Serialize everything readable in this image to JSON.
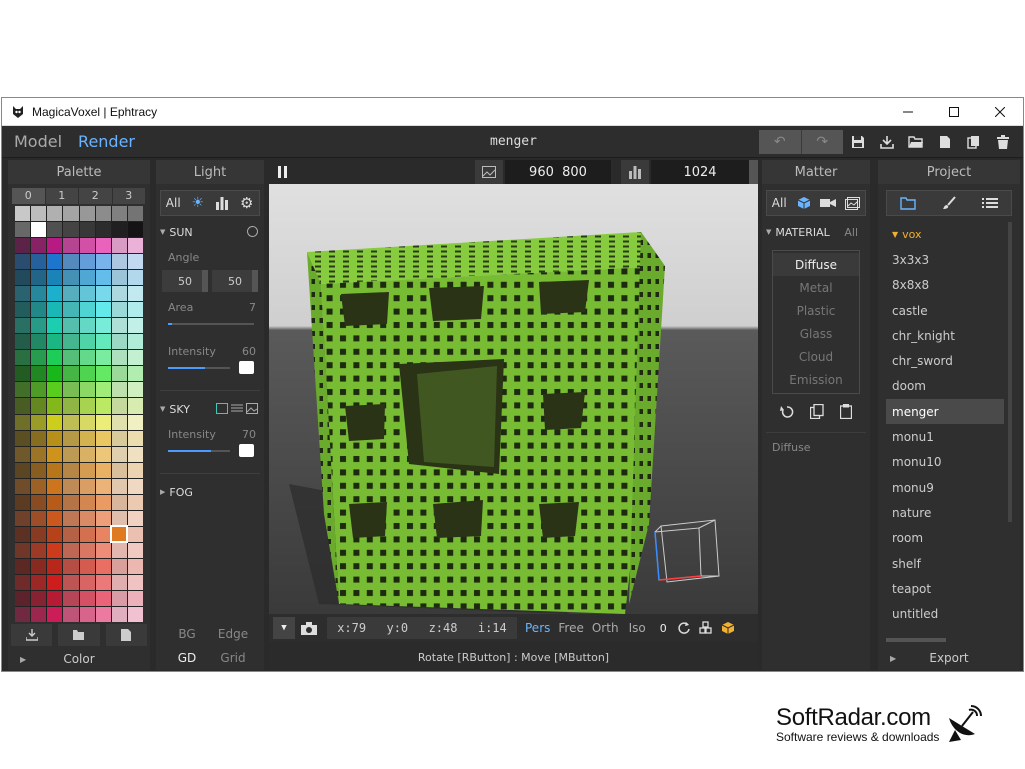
{
  "window": {
    "title": "MagicaVoxel | Ephtracy",
    "controls": [
      "minimize",
      "maximize",
      "close"
    ]
  },
  "menubar": {
    "tabs": [
      {
        "label": "Model",
        "active": false
      },
      {
        "label": "Render",
        "active": true
      }
    ],
    "document": "menger",
    "icons": [
      "undo-icon",
      "redo-icon",
      "save-icon",
      "download-icon",
      "open-folder-icon",
      "new-file-icon",
      "copy-icon",
      "delete-icon"
    ]
  },
  "palette": {
    "title": "Palette",
    "tabs": [
      "0",
      "1",
      "2",
      "3"
    ],
    "active_tab": 0,
    "selected_row": 20,
    "selected_col": 6,
    "footer": "Color"
  },
  "light": {
    "title": "Light",
    "filter_all": "All",
    "sun": {
      "label": "SUN",
      "angle_label": "Angle",
      "angle": [
        "50",
        "50"
      ],
      "area_label": "Area",
      "area": "7",
      "area_fraction": 0.05,
      "intensity_label": "Intensity",
      "intensity": "60",
      "intensity_fraction": 0.6
    },
    "sky": {
      "label": "SKY",
      "intensity_label": "Intensity",
      "intensity": "70",
      "intensity_fraction": 0.7
    },
    "fog": {
      "label": "FOG"
    },
    "bottom": [
      {
        "label": "BG",
        "on": false
      },
      {
        "label": "Edge",
        "on": false
      },
      {
        "label": "GD",
        "on": true
      },
      {
        "label": "Grid",
        "on": false
      }
    ]
  },
  "viewport": {
    "resolution": "960  800",
    "samples": "1024",
    "coords": {
      "x": "x:79",
      "y": "y:0",
      "z": "z:48",
      "i": "i:14"
    },
    "projection": [
      {
        "label": "Pers",
        "active": true
      },
      {
        "label": "Free",
        "active": false
      },
      {
        "label": "Orth",
        "active": false
      },
      {
        "label": "Iso",
        "active": false
      }
    ],
    "zoom": "0",
    "status": "Rotate [RButton] : Move [MButton]",
    "model_color": "#7dc23a"
  },
  "matter": {
    "title": "Matter",
    "filter_all": "All",
    "material_label": "MATERIAL",
    "material_all": "All",
    "materials": [
      {
        "label": "Diffuse",
        "active": true
      },
      {
        "label": "Metal",
        "active": false
      },
      {
        "label": "Plastic",
        "active": false
      },
      {
        "label": "Glass",
        "active": false
      },
      {
        "label": "Cloud",
        "active": false
      },
      {
        "label": "Emission",
        "active": false
      }
    ],
    "current": "Diffuse"
  },
  "project": {
    "title": "Project",
    "folder": "vox",
    "items": [
      "3x3x3",
      "8x8x8",
      "castle",
      "chr_knight",
      "chr_sword",
      "doom",
      "menger",
      "monu1",
      "monu10",
      "monu9",
      "nature",
      "room",
      "shelf",
      "teapot",
      "untitled"
    ],
    "selected": "menger",
    "export": "Export"
  },
  "brand": {
    "name": "SoftRadar.com",
    "tagline": "Software reviews & downloads"
  }
}
